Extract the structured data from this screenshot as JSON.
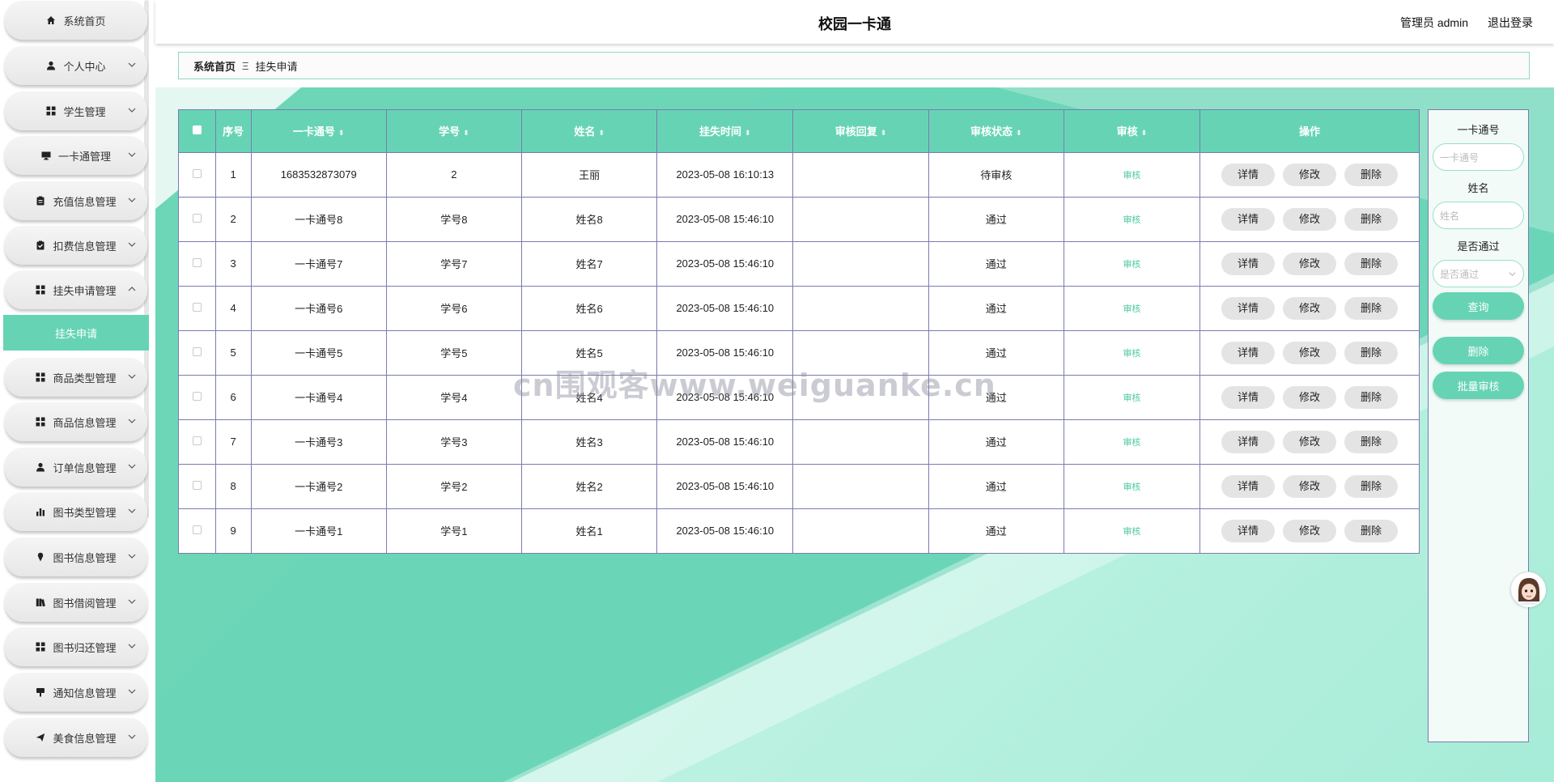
{
  "app_title": "校园一卡通",
  "header": {
    "admin_text": "管理员 admin",
    "logout_label": "退出登录"
  },
  "sidebar": {
    "items": [
      {
        "label": "系统首页",
        "icon": "home-icon",
        "chevron": false
      },
      {
        "label": "个人中心",
        "icon": "user-icon",
        "chevron": true
      },
      {
        "label": "学生管理",
        "icon": "grid-icon",
        "chevron": true
      },
      {
        "label": "一卡通管理",
        "icon": "monitor-icon",
        "chevron": true
      },
      {
        "label": "充值信息管理",
        "icon": "clipboard-icon",
        "chevron": true
      },
      {
        "label": "扣费信息管理",
        "icon": "clipboard-check-icon",
        "chevron": true
      },
      {
        "label": "挂失申请管理",
        "icon": "grid-icon",
        "chevron": "up"
      },
      {
        "label": "商品类型管理",
        "icon": "grid-icon",
        "chevron": true
      },
      {
        "label": "商品信息管理",
        "icon": "grid-icon",
        "chevron": true
      },
      {
        "label": "订单信息管理",
        "icon": "user-icon",
        "chevron": true
      },
      {
        "label": "图书类型管理",
        "icon": "bar-chart-icon",
        "chevron": true
      },
      {
        "label": "图书信息管理",
        "icon": "pin-icon",
        "chevron": true
      },
      {
        "label": "图书借阅管理",
        "icon": "book-icon",
        "chevron": true
      },
      {
        "label": "图书归还管理",
        "icon": "grid-icon",
        "chevron": true
      },
      {
        "label": "通知信息管理",
        "icon": "sign-icon",
        "chevron": true
      },
      {
        "label": "美食信息管理",
        "icon": "send-icon",
        "chevron": true
      }
    ],
    "active_sub": "挂失申请"
  },
  "breadcrumb": {
    "home": "系统首页",
    "separator": "Ξ",
    "current": "挂失申请"
  },
  "table": {
    "columns": [
      "序号",
      "一卡通号",
      "学号",
      "姓名",
      "挂失时间",
      "审核回复",
      "审核状态",
      "审核",
      "操作"
    ],
    "sortable": [
      false,
      true,
      true,
      true,
      true,
      true,
      true,
      true,
      false
    ],
    "rows": [
      {
        "no": "1",
        "card": "1683532873079",
        "student_id": "2",
        "name": "王丽",
        "time": "2023-05-08 16:10:13",
        "reply": "",
        "status": "待审核",
        "audit": "审核"
      },
      {
        "no": "2",
        "card": "一卡通号8",
        "student_id": "学号8",
        "name": "姓名8",
        "time": "2023-05-08 15:46:10",
        "reply": "",
        "status": "通过",
        "audit": "审核"
      },
      {
        "no": "3",
        "card": "一卡通号7",
        "student_id": "学号7",
        "name": "姓名7",
        "time": "2023-05-08 15:46:10",
        "reply": "",
        "status": "通过",
        "audit": "审核"
      },
      {
        "no": "4",
        "card": "一卡通号6",
        "student_id": "学号6",
        "name": "姓名6",
        "time": "2023-05-08 15:46:10",
        "reply": "",
        "status": "通过",
        "audit": "审核"
      },
      {
        "no": "5",
        "card": "一卡通号5",
        "student_id": "学号5",
        "name": "姓名5",
        "time": "2023-05-08 15:46:10",
        "reply": "",
        "status": "通过",
        "audit": "审核"
      },
      {
        "no": "6",
        "card": "一卡通号4",
        "student_id": "学号4",
        "name": "姓名4",
        "time": "2023-05-08 15:46:10",
        "reply": "",
        "status": "通过",
        "audit": "审核"
      },
      {
        "no": "7",
        "card": "一卡通号3",
        "student_id": "学号3",
        "name": "姓名3",
        "time": "2023-05-08 15:46:10",
        "reply": "",
        "status": "通过",
        "audit": "审核"
      },
      {
        "no": "8",
        "card": "一卡通号2",
        "student_id": "学号2",
        "name": "姓名2",
        "time": "2023-05-08 15:46:10",
        "reply": "",
        "status": "通过",
        "audit": "审核"
      },
      {
        "no": "9",
        "card": "一卡通号1",
        "student_id": "学号1",
        "name": "姓名1",
        "time": "2023-05-08 15:46:10",
        "reply": "",
        "status": "通过",
        "audit": "审核"
      }
    ],
    "actions": [
      "详情",
      "修改",
      "删除"
    ]
  },
  "search": {
    "card_label": "一卡通号",
    "card_placeholder": "一卡通号",
    "name_label": "姓名",
    "name_placeholder": "姓名",
    "pass_label": "是否通过",
    "pass_placeholder": "是否通过",
    "query_button": "查询",
    "delete_button": "删除",
    "batch_audit_button": "批量审核"
  },
  "watermark": "cn围观客www.weiguanke.cn",
  "colors": {
    "accent": "#66d4b4",
    "border": "#7b7bb0",
    "audit_link": "#4cc9a0"
  }
}
